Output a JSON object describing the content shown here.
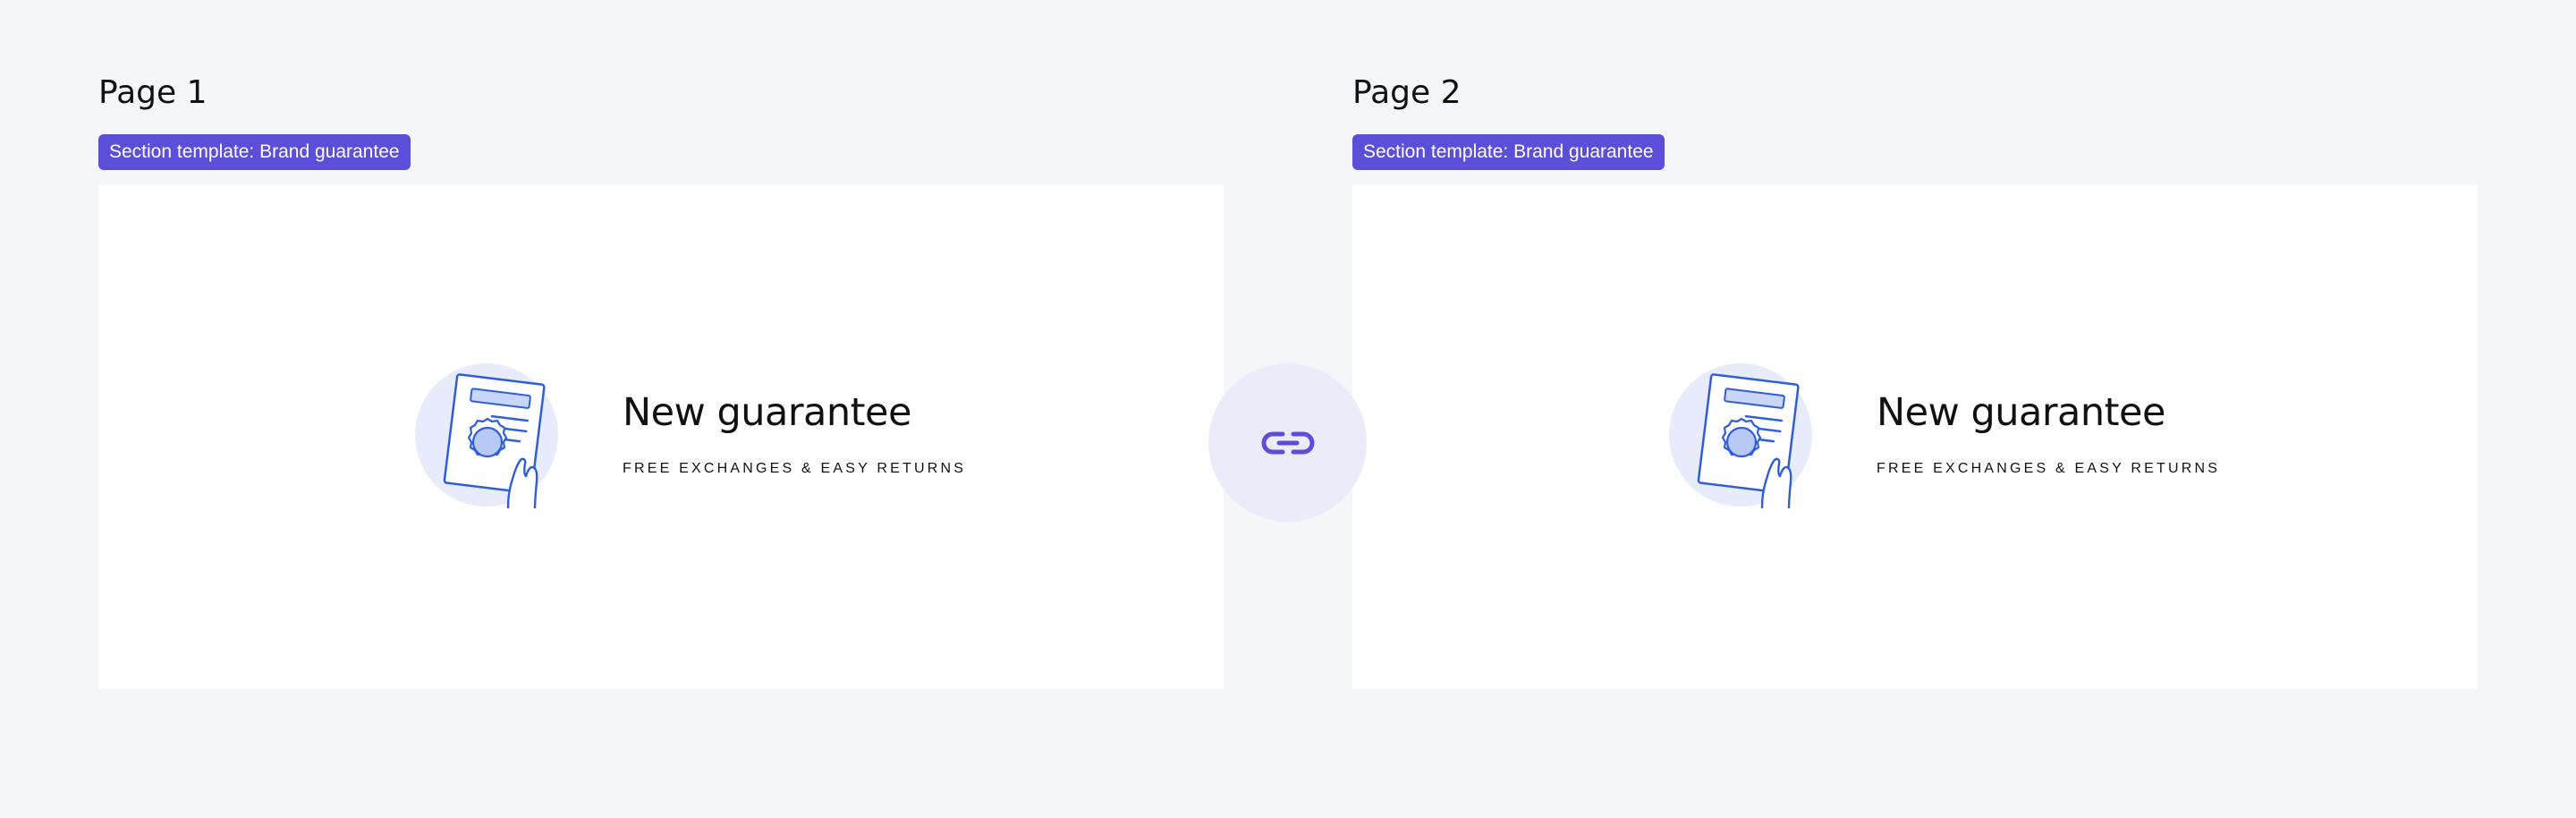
{
  "pages": [
    {
      "title": "Page 1",
      "badge": "Section template: Brand guarantee",
      "section": {
        "icon": "certificate-icon",
        "heading": "New guarantee",
        "subheading": "FREE EXCHANGES & EASY RETURNS"
      }
    },
    {
      "title": "Page 2",
      "badge": "Section template: Brand guarantee",
      "section": {
        "icon": "certificate-icon",
        "heading": "New guarantee",
        "subheading": "FREE EXCHANGES & EASY RETURNS"
      }
    }
  ],
  "link_button": {
    "icon": "link-icon"
  },
  "colors": {
    "background": "#f5f6fa",
    "accent": "#5b4fd9",
    "icon_blue": "#2f5fd8",
    "icon_circle": "#e8ecfa",
    "link_circle": "#ecebfa"
  }
}
